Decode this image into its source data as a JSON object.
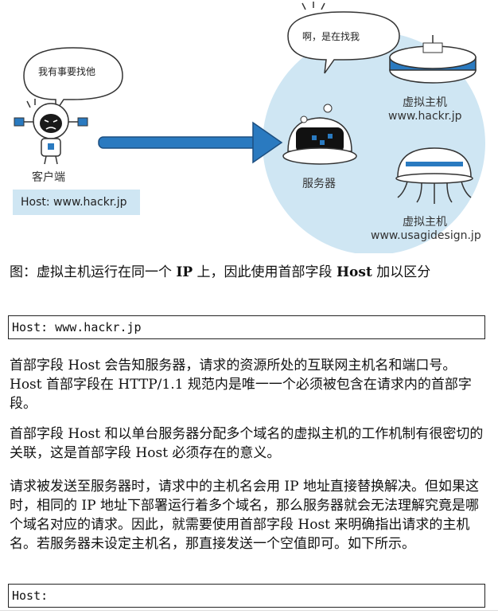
{
  "figure": {
    "client_bubble": "我有事要找他",
    "server_bubble": "啊，是在找我",
    "client_label": "客户端",
    "host_badge": "Host: www.hackr.jp",
    "server_label": "服务器",
    "vhost1_title": "虚拟主机",
    "vhost1_domain": "www.hackr.jp",
    "vhost2_title": "虚拟主机",
    "vhost2_domain": "www.usagidesign.jp"
  },
  "caption": {
    "prefix": "图：虚拟主机运行在同一个 ",
    "ip": "IP",
    "middle": " 上，因此使用首部字段 ",
    "host": "Host",
    "suffix": " 加以区分"
  },
  "code1": "Host: www.hackr.jp",
  "paragraphs": [
    "首部字段 Host 会告知服务器，请求的资源所处的互联网主机名和端口号。Host 首部字段在 HTTP/1.1 规范内是唯一一个必须被包含在请求内的首部字段。",
    "首部字段 Host 和以单台服务器分配多个域名的虚拟主机的工作机制有很密切的关联，这是首部字段 Host 必须存在的意义。",
    "请求被发送至服务器时，请求中的主机名会用 IP 地址直接替换解决。但如果这时，相同的 IP 地址下部署运行着多个域名，那么服务器就会无法理解究竟是哪个域名对应的请求。因此，就需要使用首部字段 Host 来明确指出请求的主机名。若服务器未设定主机名，那直接发送一个空值即可。如下所示。"
  ],
  "code2": "Host:"
}
